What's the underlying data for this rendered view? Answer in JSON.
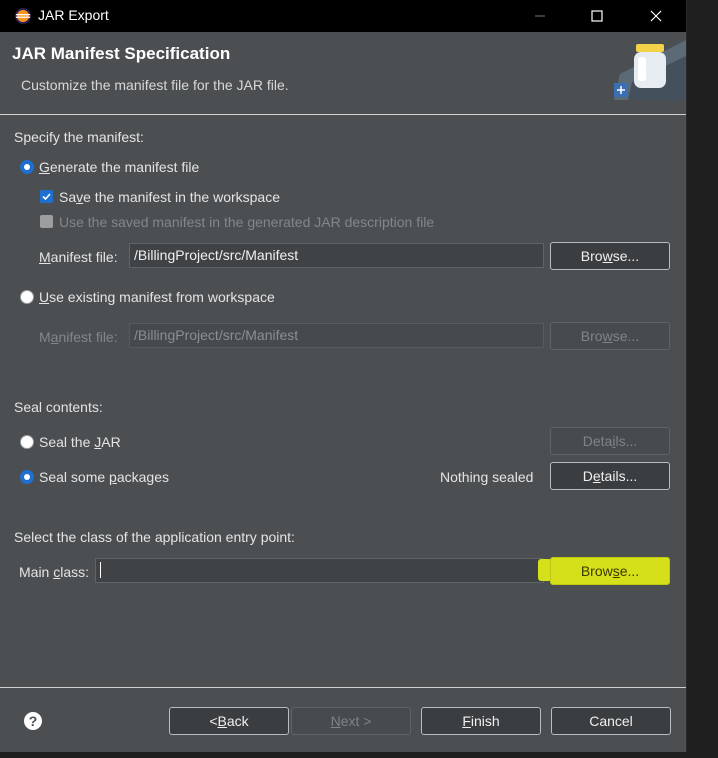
{
  "window": {
    "title": "JAR Export"
  },
  "header": {
    "title": "JAR Manifest Specification",
    "description": "Customize the manifest file for the JAR file."
  },
  "manifest": {
    "section_label": "Specify the manifest:",
    "generate": {
      "pre": "",
      "u": "G",
      "post": "enerate the manifest file",
      "selected": true
    },
    "save": {
      "pre": "Sa",
      "u": "v",
      "post": "e the manifest in the workspace",
      "checked": true
    },
    "use_saved": {
      "label": "Use the saved manifest in the generated JAR description file",
      "checked": false
    },
    "manifest_file_label": {
      "pre": "",
      "u": "M",
      "post": "anifest file:"
    },
    "manifest_file_value": "/BillingProject/src/Manifest",
    "browse_1": {
      "pre": "Bro",
      "u": "w",
      "post": "se..."
    },
    "use_existing": {
      "pre": "",
      "u": "U",
      "post": "se existing manifest from workspace",
      "selected": false
    },
    "manifest_file_label_2": {
      "pre": "M",
      "u": "a",
      "post": "nifest file:"
    },
    "manifest_file_value_2": "/BillingProject/src/Manifest",
    "browse_2": {
      "pre": "Bro",
      "u": "w",
      "post": "se..."
    }
  },
  "seal": {
    "section_label": "Seal contents:",
    "seal_jar": {
      "pre": "Seal the ",
      "u": "J",
      "post": "AR",
      "selected": false
    },
    "details_1": {
      "pre": "Deta",
      "u": "i",
      "post": "ls..."
    },
    "seal_some": {
      "pre": "Seal some ",
      "u": "p",
      "post": "ackages",
      "selected": true
    },
    "status": "Nothing sealed",
    "details_2": {
      "pre": "D",
      "u": "e",
      "post": "tails..."
    }
  },
  "entry": {
    "section_label": "Select the class of the application entry point:",
    "main_class_label": {
      "pre": "Main ",
      "u": "c",
      "post": "lass:"
    },
    "main_class_value": "",
    "browse": {
      "pre": "Brow",
      "u": "s",
      "post": "e..."
    }
  },
  "footer": {
    "back": {
      "pre": "< ",
      "u": "B",
      "post": "ack"
    },
    "next": {
      "pre": "",
      "u": "N",
      "post": "ext >"
    },
    "finish": {
      "pre": "",
      "u": "F",
      "post": "inish"
    },
    "cancel": "Cancel"
  },
  "colors": {
    "accent": "#1f6fd1",
    "highlight": "#d6e01a",
    "dialog_bg": "#4b4f52"
  }
}
